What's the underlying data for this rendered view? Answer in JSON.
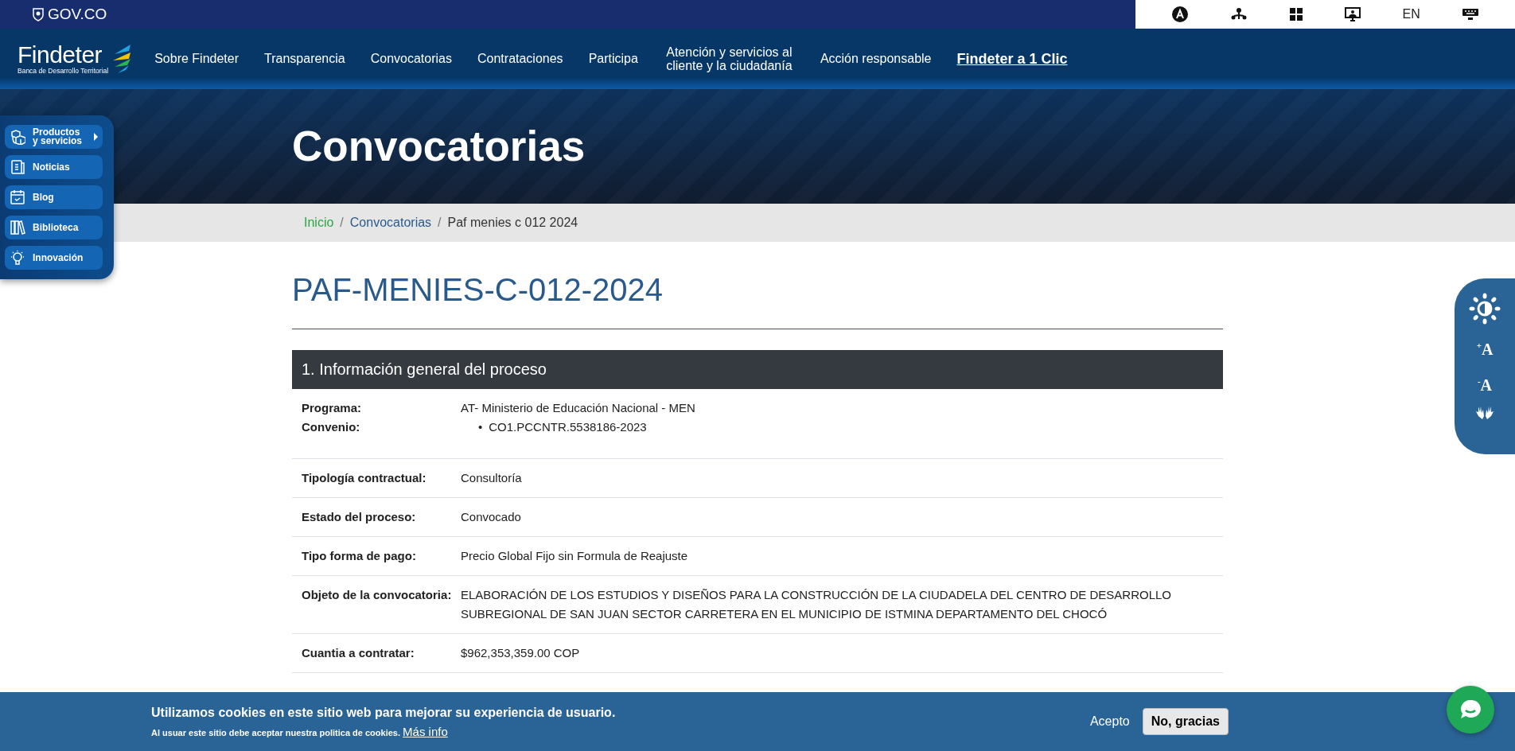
{
  "gov_bar": {
    "logo": "GOV.CO",
    "language": "EN"
  },
  "nav": {
    "logo": "Findeter",
    "tagline": "Banca de Desarrollo Territorial",
    "items": [
      {
        "label": "Sobre Findeter",
        "kind": "link"
      },
      {
        "label": "Transparencia",
        "kind": "link"
      },
      {
        "label": "Convocatorias",
        "kind": "link"
      },
      {
        "label": "Contrataciones",
        "kind": "link"
      },
      {
        "label": "Participa",
        "kind": "link"
      },
      {
        "label": "Atención y servicios al cliente y la ciudadanía",
        "kind": "link"
      },
      {
        "label": "Acción responsable",
        "kind": "link"
      },
      {
        "label": "Findeter a 1 Clic",
        "kind": "highlight"
      }
    ]
  },
  "side_menu": [
    {
      "label": "Productos y servicios",
      "has_submenu": true
    },
    {
      "label": "Noticias",
      "has_submenu": false
    },
    {
      "label": "Blog",
      "has_submenu": false
    },
    {
      "label": "Biblioteca",
      "has_submenu": false
    },
    {
      "label": "Innovación",
      "has_submenu": false
    }
  ],
  "hero": {
    "title": "Convocatorias"
  },
  "breadcrumb": [
    {
      "label": "Inicio",
      "kind": "home"
    },
    {
      "label": "Convocatorias",
      "kind": "link",
      "separator": "/"
    },
    {
      "label": "Paf menies c 012 2024",
      "kind": "current",
      "separator": "/"
    }
  ],
  "page_title": "PAF-MENIES-C-012-2024",
  "section": {
    "title": "1. Información general del proceso",
    "rows": [
      {
        "label": "Programa:",
        "value": "AT- Ministerio de Educación Nacional - MEN",
        "sub_label": "Convenio:",
        "sub_items": [
          {
            "bullet": "•",
            "text": "CO1.PCCNTR.5538186-2023"
          }
        ]
      },
      {
        "label": "Tipología contractual:",
        "value": "Consultoría"
      },
      {
        "label": "Estado del proceso:",
        "value": "Convocado"
      },
      {
        "label": "Tipo forma de pago:",
        "value": "Precio Global Fijo sin Formula de Reajuste"
      },
      {
        "label": "Objeto de la convocatoria:",
        "value": "ELABORACIÓN DE LOS ESTUDIOS Y DISEÑOS PARA LA CONSTRUCCIÓN DE LA CIUDADELA DEL CENTRO DE DESARROLLO SUBREGIONAL DE SAN JUAN SECTOR CARRETERA EN EL MUNICIPIO DE ISTMINA DEPARTAMENTO DEL CHOCÓ"
      },
      {
        "label": "Cuantia a contratar:",
        "value": "$962,353,359.00 COP"
      }
    ]
  },
  "accessibility": {
    "increase": "$^{+}$A",
    "decrease": "$^{-}$A"
  },
  "cookie_bar": {
    "message": "Utilizamos cookies en este sitio web para mejorar su experiencia de usuario.",
    "notice": "Al usuar este sitio debe aceptar nuestra politica de cookies.",
    "link": "Más info",
    "accept": "Acepto",
    "decline": "No, gracias"
  }
}
